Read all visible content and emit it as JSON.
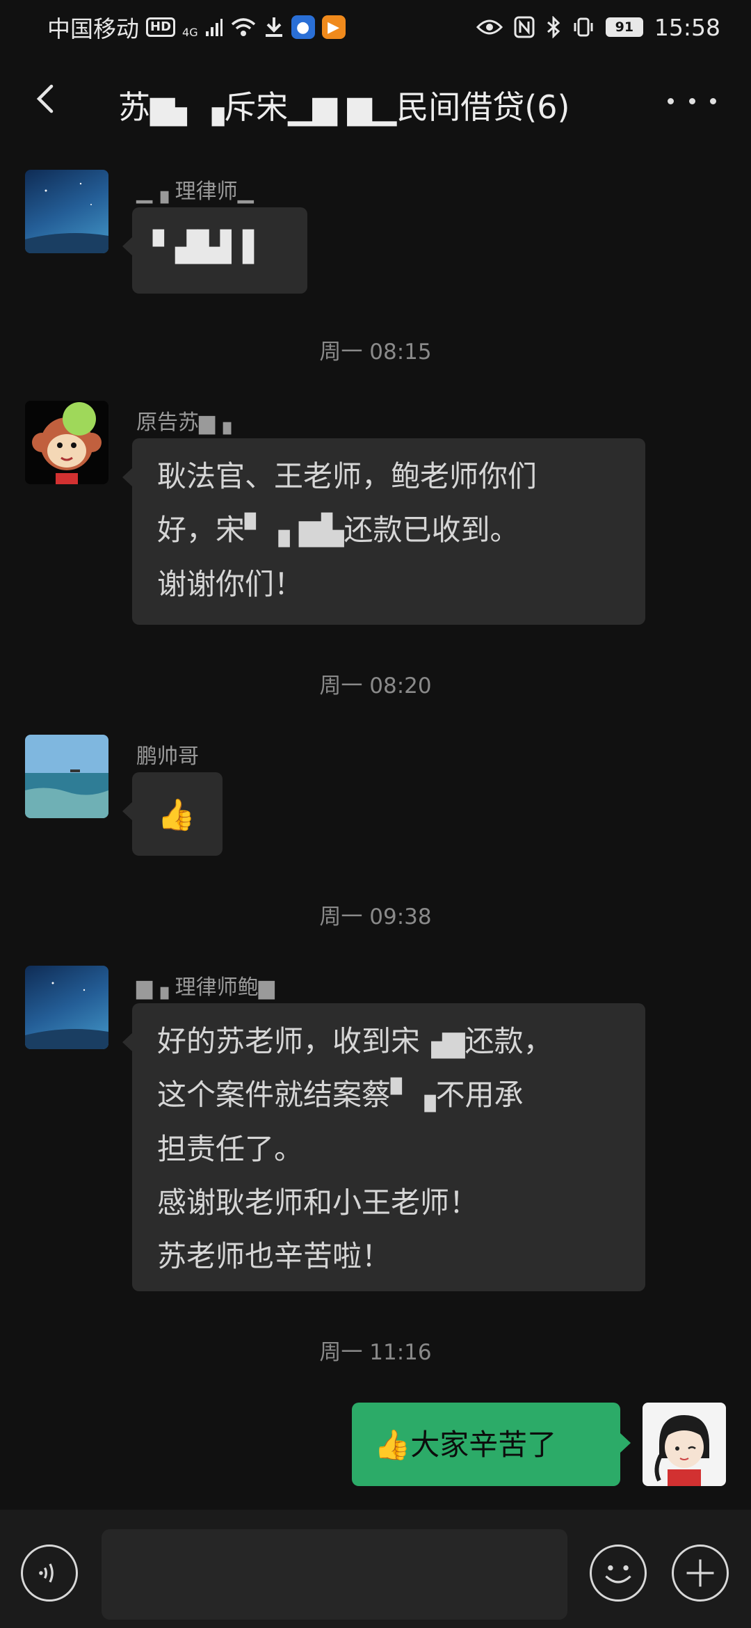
{
  "status_bar": {
    "carrier": "中国移动",
    "network": "4G",
    "battery": "91",
    "time": "15:58"
  },
  "nav": {
    "title": "苏▆▖▗斥宋▁▆ ▆▁民间借贷(6)"
  },
  "messages": [
    {
      "sender": "▁▗ 理律师▁",
      "text": [
        "▘▟▙▌▌"
      ]
    },
    {
      "timestamp": "周一 08:15"
    },
    {
      "sender": "原告苏▆▗",
      "text": [
        "耿法官、王老师，鲍老师你们",
        "好，宋▘▗  ▆▙还款已收到。",
        "谢谢你们！"
      ]
    },
    {
      "timestamp": "周一 08:20"
    },
    {
      "sender": "鹏帅哥",
      "text": [
        "👍"
      ]
    },
    {
      "timestamp": "周一 09:38"
    },
    {
      "sender": "▆▗ 理律师鲍▆",
      "text": [
        "好的苏老师，收到宋▗▆还款，",
        "这个案件就结案蔡▘▗不用承",
        "担责任了。",
        "感谢耿老师和小王老师！",
        "苏老师也辛苦啦！"
      ]
    },
    {
      "timestamp": "周一 11:16"
    },
    {
      "sender": "",
      "text": [
        "👍大家辛苦了"
      ]
    }
  ],
  "icons": {
    "back": "chevron-left-icon",
    "more": "more-dots-icon",
    "voice": "voice-input-icon",
    "emoji": "emoji-icon",
    "plus": "plus-icon"
  },
  "colors": {
    "background": "#111111",
    "bubble_other": "#2c2c2c",
    "bubble_self": "#2cab68",
    "input_bar": "#1b1b1b"
  }
}
